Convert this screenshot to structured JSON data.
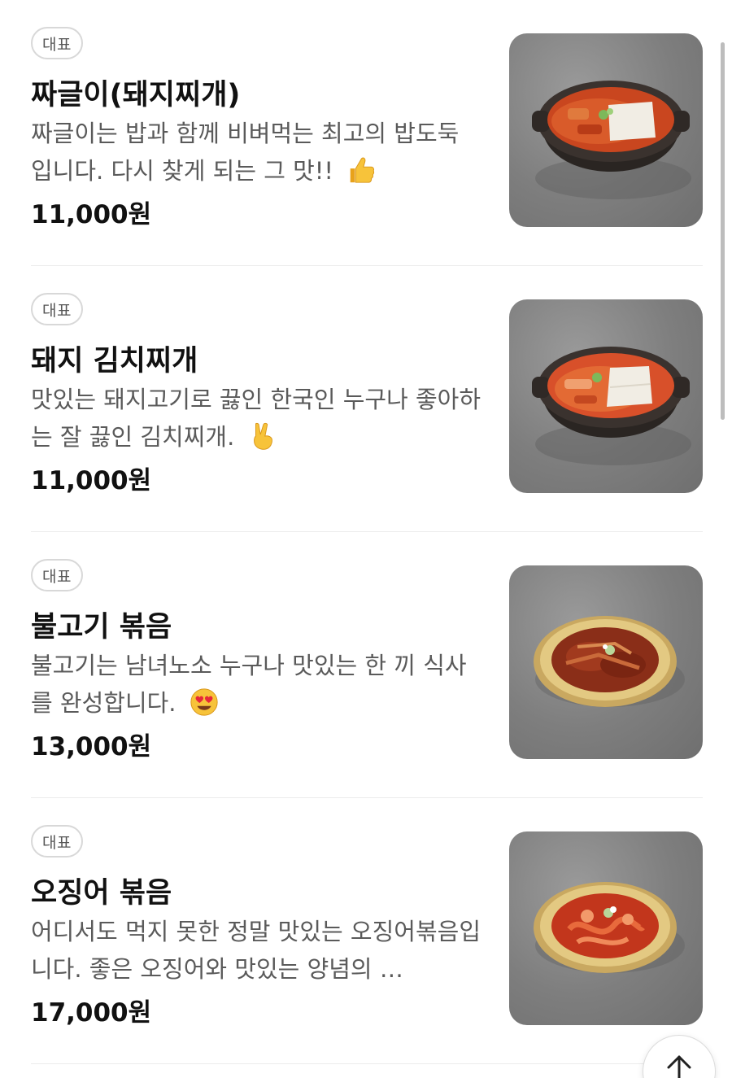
{
  "menu": {
    "items": [
      {
        "badge": "대표",
        "name": "짜글이(돼지찌개)",
        "description": "짜글이는 밥과 함께 비벼먹는 최고의 밥도둑 입니다. 다시 찾게 되는 그 맛!!",
        "emoji": "thumbs-up",
        "price": "11,000원",
        "image": "pork-jjageuli-stew-pot"
      },
      {
        "badge": "대표",
        "name": "돼지 김치찌개",
        "description": "맛있는 돼지고기로 끓인 한국인 누구나 좋아하는 잘 끓인 김치찌개.",
        "emoji": "victory-hand",
        "price": "11,000원",
        "image": "kimchi-stew-pot"
      },
      {
        "badge": "대표",
        "name": "불고기 볶음",
        "description": "불고기는 남녀노소 누구나 맛있는 한 끼 식사를 완성합니다.",
        "emoji": "heart-eyes",
        "price": "13,000원",
        "image": "bulgogi-plate"
      },
      {
        "badge": "대표",
        "name": "오징어 볶음",
        "description": "어디서도 먹지 못한 정말 맛있는 오징어볶음입니다. 좋은 오징어와 맛있는 양념의 …",
        "emoji": "",
        "price": "17,000원",
        "image": "spicy-squid-plate"
      }
    ]
  },
  "colors": {
    "text_primary": "#111111",
    "text_secondary": "#5a5a5a",
    "badge_border": "#d8d8d8",
    "divider": "#ececec",
    "image_bg": "#8a8a8a"
  }
}
